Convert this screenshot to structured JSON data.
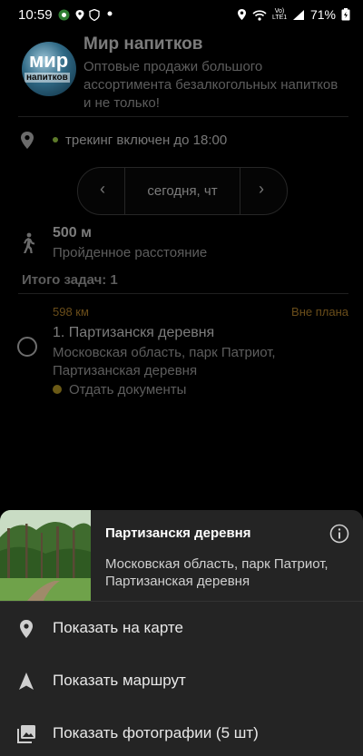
{
  "status_bar": {
    "time": "10:59",
    "battery": "71%",
    "network": "Vo) LTE1"
  },
  "company": {
    "logo_text_top": "мир",
    "logo_text_bottom": "напитков",
    "name": "Мир напитков",
    "description": "Оптовые продажи большого ассортимента безалкогольных напитков и не только!"
  },
  "tracking": {
    "text": "трекинг включен до 18:00"
  },
  "date_nav": {
    "prev_icon": "‹",
    "label": "сегодня, чт",
    "next_icon": "›"
  },
  "distance": {
    "value": "500 м",
    "label": "Пройденное расстояние"
  },
  "tasks_total": "Итого задач: 1",
  "tasks": [
    {
      "distance": "598 км",
      "plan_status": "Вне плана",
      "title": "1.  Партизанскя деревня",
      "address": "Московская область, парк Патриот, Партизанская деревня",
      "todo": "Отдать документы"
    }
  ],
  "bottom_sheet": {
    "title": "Партизанскя деревня",
    "address": "Московская область, парк Патриот, Партизанская деревня",
    "actions": [
      {
        "label": "Показать на карте",
        "icon": "map-pin-icon"
      },
      {
        "label": "Показать маршрут",
        "icon": "navigation-arrow-icon"
      },
      {
        "label": "Показать фотографии (5 шт)",
        "icon": "photos-icon"
      }
    ]
  },
  "colors": {
    "accent_orange": "#6a4d1a",
    "tracking_dot": "#5d7a2a",
    "task_dot": "#6b5a16",
    "sheet_bg": "#242424"
  }
}
